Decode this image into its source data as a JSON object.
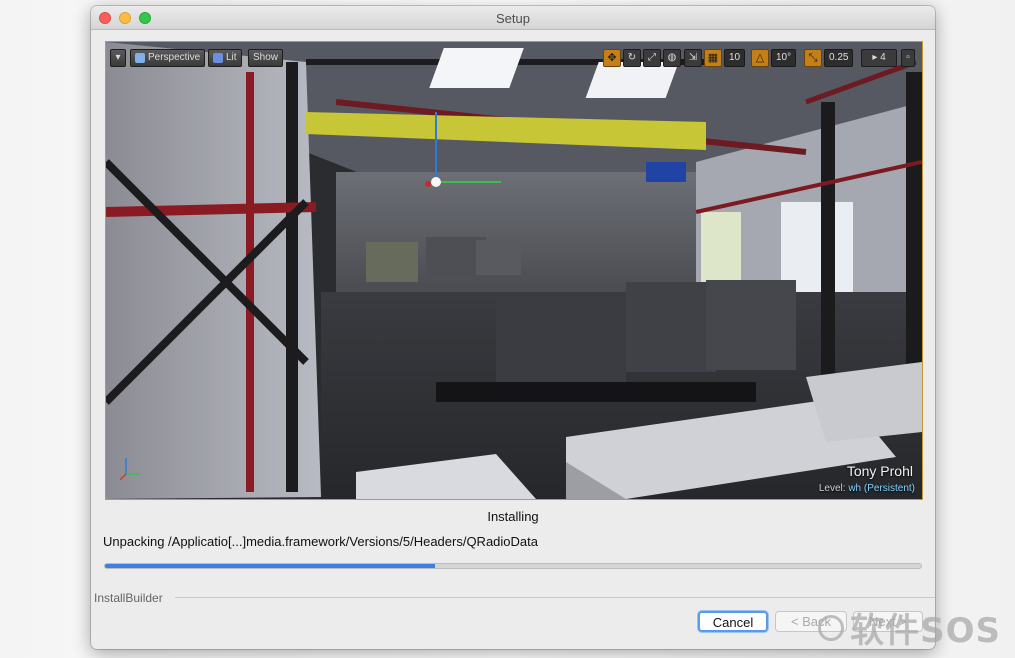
{
  "window": {
    "title": "Setup"
  },
  "viewport": {
    "toolbar": {
      "menu_icon": "chevron-down-icon",
      "perspective_label": "Perspective",
      "lit_label": "Lit",
      "show_label": "Show",
      "grid_snap_value": "10",
      "rotation_snap_value": "10°",
      "scale_snap_value": "0.25",
      "camera_speed_value": "4"
    },
    "overlay": {
      "author": "Tony Prohl",
      "level_label": "Level:",
      "level_value": "wh (Persistent)"
    }
  },
  "status": {
    "heading": "Installing",
    "detail": "Unpacking /Applicatio[...]media.framework/Versions/5/Headers/QRadioData",
    "progress": 0.405
  },
  "footer": {
    "brand": "InstallBuilder",
    "cancel_label": "Cancel",
    "back_label": "< Back",
    "next_label": "Next >"
  },
  "watermark": {
    "text": "软件SOS"
  },
  "colors": {
    "accent": "#3f7fe0",
    "viewport_border": "#c49b2f"
  }
}
